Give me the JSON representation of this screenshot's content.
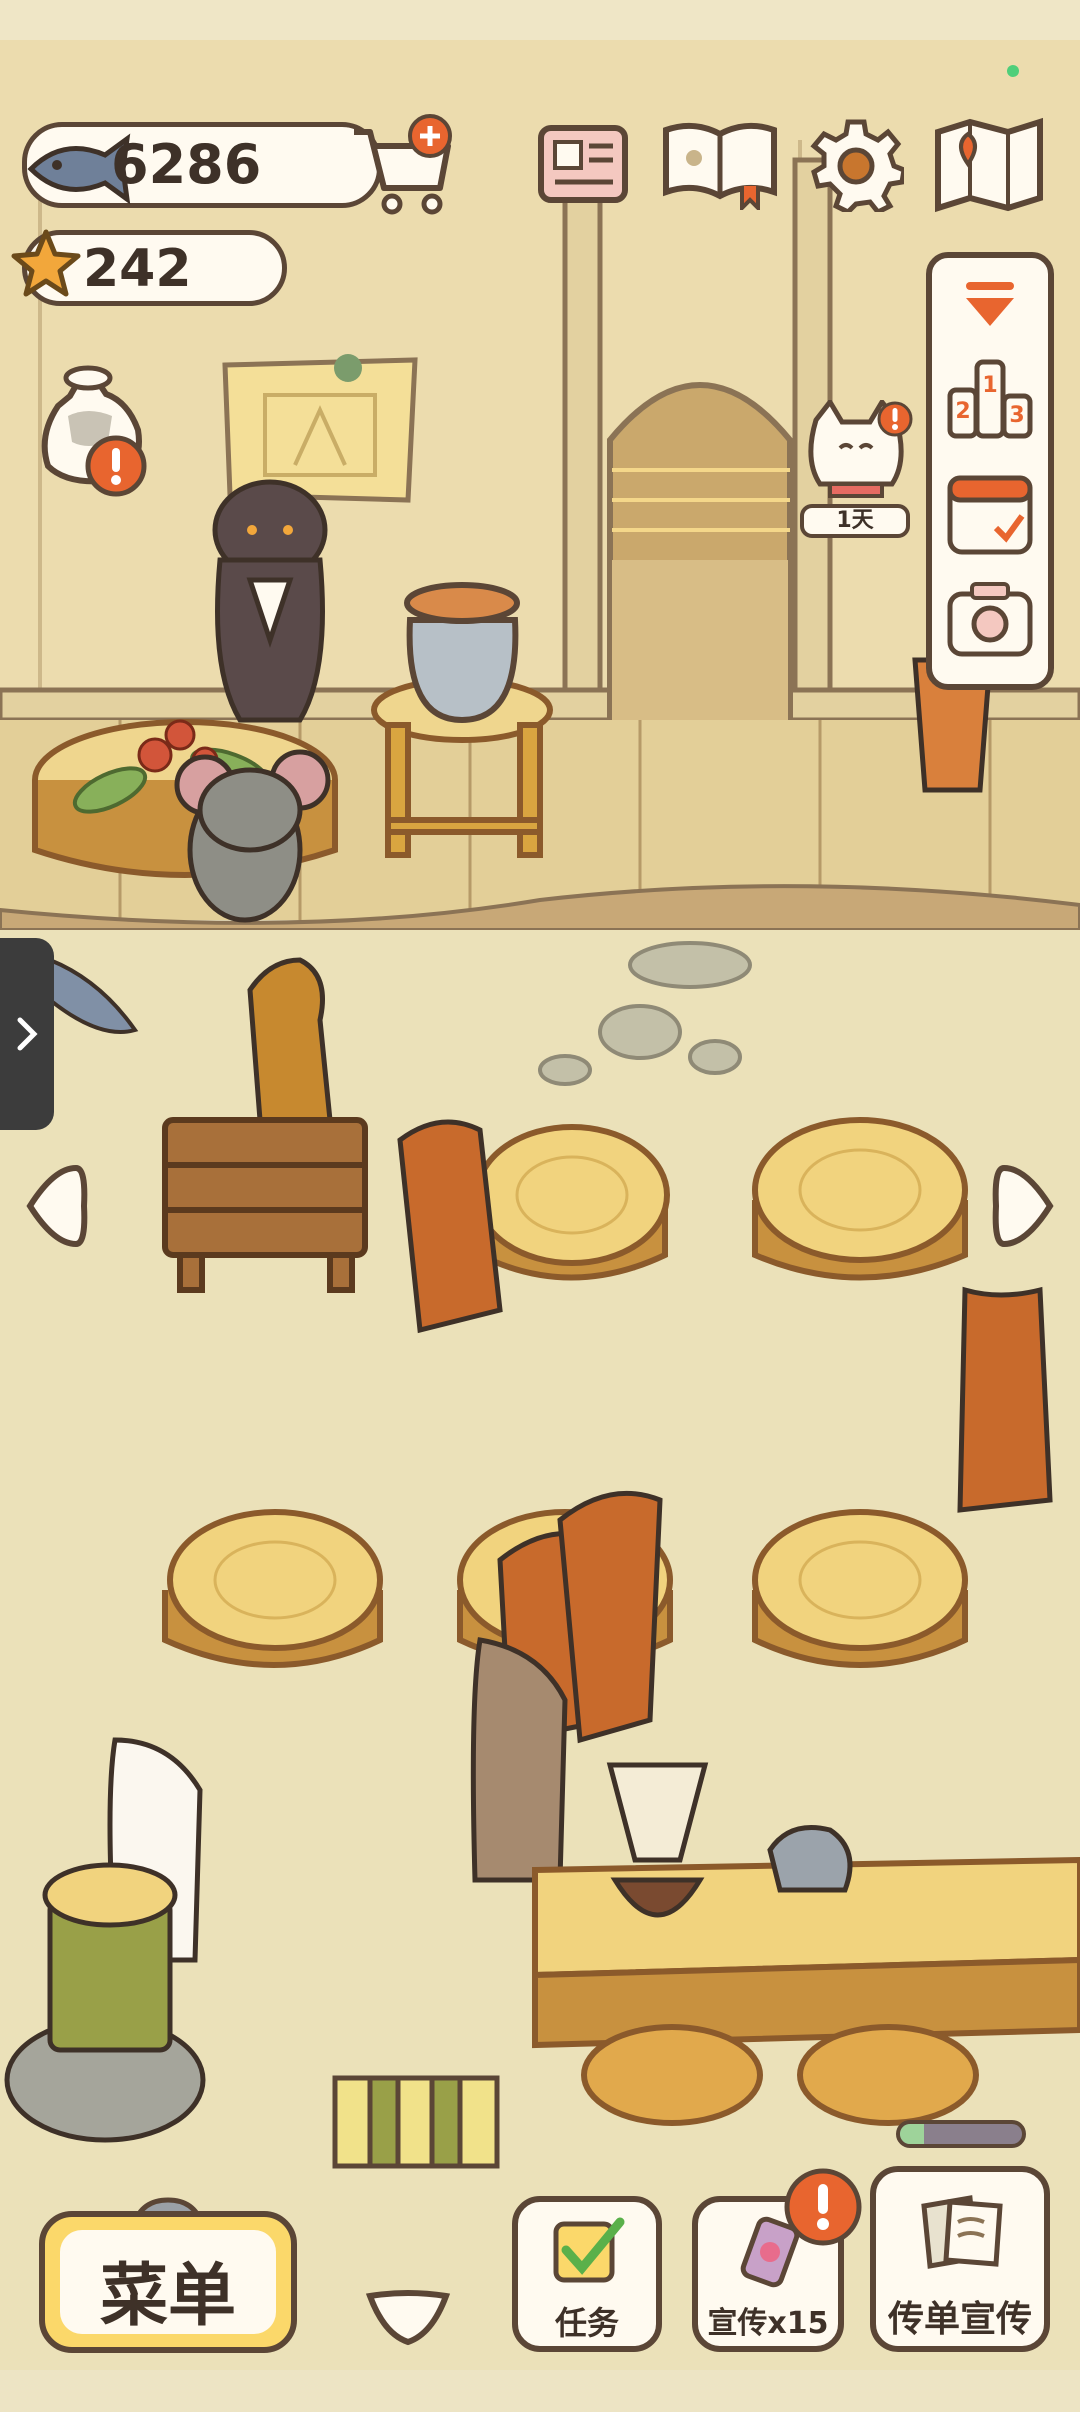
{
  "hud": {
    "fish_count": "6286",
    "star_count": "242",
    "timer_badge": "1天"
  },
  "bottom_bar": {
    "menu_label": "菜单",
    "task_label": "任务",
    "promo_label": "宣传x15",
    "flyer_label": "传单宣传"
  },
  "icons": {
    "fish": "fish-icon",
    "cart": "shopping-cart-plus-icon",
    "news": "newspaper-icon",
    "book": "paw-book-icon",
    "settings": "gear-icon",
    "map": "map-pin-icon",
    "star": "star-icon",
    "collapse": "chevron-down-icon",
    "ranking": "podium-ranking-icon",
    "calendar": "calendar-check-icon",
    "camera": "camera-icon",
    "drawer": "chevron-right-icon",
    "prev": "arrow-left-icon",
    "next": "arrow-right-icon",
    "alert": "exclamation-icon"
  },
  "colors": {
    "wall": "#ecdcae",
    "floor": "#ebe1b9",
    "outline": "#5b4636",
    "menu_yellow": "#fbd86a",
    "alert_orange": "#e8652f",
    "progress_green": "#9ed39a"
  },
  "progress": {
    "bottom_progress": 0.2
  }
}
